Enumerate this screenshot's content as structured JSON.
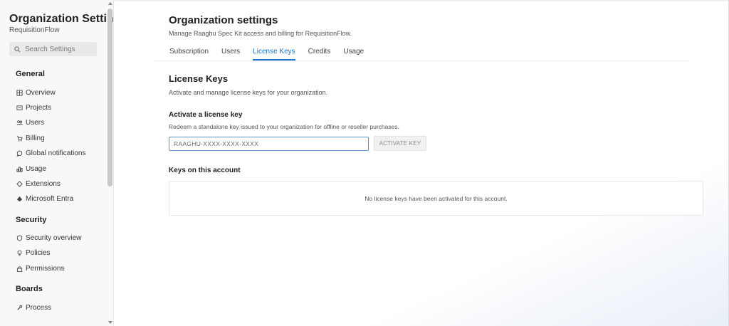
{
  "sidebar": {
    "title": "Organization Settin...",
    "subtitle": "RequisitionFlow",
    "search_placeholder": "Search Settings",
    "groups": [
      {
        "label": "General",
        "items": [
          {
            "label": "Overview",
            "icon": "grid-icon"
          },
          {
            "label": "Projects",
            "icon": "projects-icon"
          },
          {
            "label": "Users",
            "icon": "users-icon"
          },
          {
            "label": "Billing",
            "icon": "cart-icon"
          },
          {
            "label": "Global notifications",
            "icon": "chat-icon"
          },
          {
            "label": "Usage",
            "icon": "usage-icon"
          },
          {
            "label": "Extensions",
            "icon": "extensions-icon"
          },
          {
            "label": "Microsoft Entra",
            "icon": "entra-icon"
          }
        ]
      },
      {
        "label": "Security",
        "items": [
          {
            "label": "Security overview",
            "icon": "shield-icon"
          },
          {
            "label": "Policies",
            "icon": "lightbulb-icon"
          },
          {
            "label": "Permissions",
            "icon": "lock-icon"
          }
        ]
      },
      {
        "label": "Boards",
        "items": [
          {
            "label": "Process",
            "icon": "process-icon"
          }
        ]
      }
    ]
  },
  "header": {
    "title": "Organization settings",
    "subtitle": "Manage Raaghu Spec Kit access and billing for RequisitionFlow."
  },
  "tabs": [
    {
      "label": "Subscription",
      "active": false
    },
    {
      "label": "Users",
      "active": false
    },
    {
      "label": "License Keys",
      "active": true
    },
    {
      "label": "Credits",
      "active": false
    },
    {
      "label": "Usage",
      "active": false
    }
  ],
  "license": {
    "title": "License Keys",
    "subtitle": "Activate and manage license keys for your organization.",
    "activate_title": "Activate a license key",
    "activate_subtitle": "Redeem a standalone key issued to your organization for offline or reseller purchases.",
    "input_placeholder": "RAAGHU-XXXX-XXXX-XXXX",
    "input_value": "",
    "activate_button": "ACTIVATE KEY",
    "keys_title": "Keys on this account",
    "keys_empty": "No license keys have been activated for this account."
  },
  "colors": {
    "accent": "#1a73c8",
    "input_border": "#5b8fd6"
  }
}
